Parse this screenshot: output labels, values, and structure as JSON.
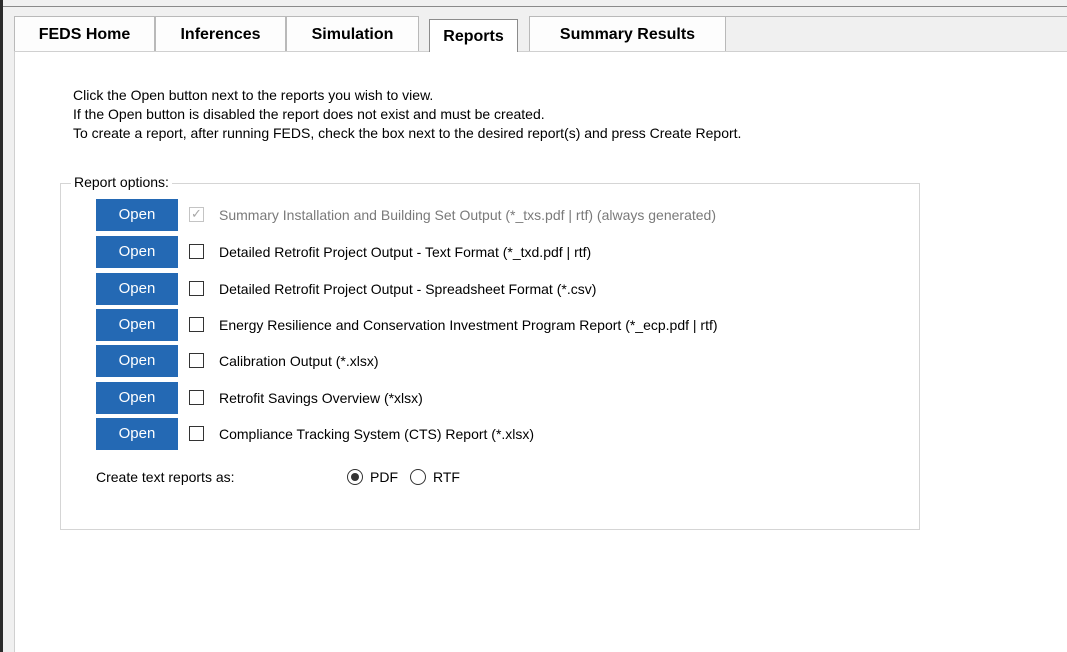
{
  "tabs": [
    {
      "label": "FEDS Home",
      "active": false
    },
    {
      "label": "Inferences",
      "active": false
    },
    {
      "label": "Simulation",
      "active": false
    },
    {
      "label": "Reports",
      "active": true
    },
    {
      "label": "Summary Results",
      "active": false
    }
  ],
  "instructions": [
    "Click the Open button next to the reports you wish to view.",
    "If the Open button is disabled the report does not exist and must be created.",
    "To create a report, after running FEDS, check the box next to the desired report(s) and press Create Report."
  ],
  "report_options": {
    "legend": "Report options:",
    "reports": [
      {
        "open_label": "Open",
        "label": "Summary Installation and Building Set Output (*_txs.pdf | rtf) (always generated)",
        "checked": true,
        "disabled": true
      },
      {
        "open_label": "Open",
        "label": "Detailed Retrofit Project Output - Text Format (*_txd.pdf | rtf)",
        "checked": false,
        "disabled": false
      },
      {
        "open_label": "Open",
        "label": "Detailed Retrofit Project Output - Spreadsheet Format (*.csv)",
        "checked": false,
        "disabled": false
      },
      {
        "open_label": "Open",
        "label": "Energy Resilience and Conservation Investment Program Report (*_ecp.pdf | rtf)",
        "checked": false,
        "disabled": false
      },
      {
        "open_label": "Open",
        "label": "Calibration Output (*.xlsx)",
        "checked": false,
        "disabled": false
      },
      {
        "open_label": "Open",
        "label": "Retrofit Savings Overview (*xlsx)",
        "checked": false,
        "disabled": false
      },
      {
        "open_label": "Open",
        "label": "Compliance Tracking System (CTS)  Report (*.xlsx)",
        "checked": false,
        "disabled": false
      }
    ],
    "format": {
      "label": "Create text reports as:",
      "options": [
        {
          "label": "PDF",
          "selected": true
        },
        {
          "label": "RTF",
          "selected": false
        }
      ]
    }
  },
  "colors": {
    "open_button": "#2469b4",
    "panel_background": "#ffffff",
    "window_background": "#f0f0f0"
  }
}
